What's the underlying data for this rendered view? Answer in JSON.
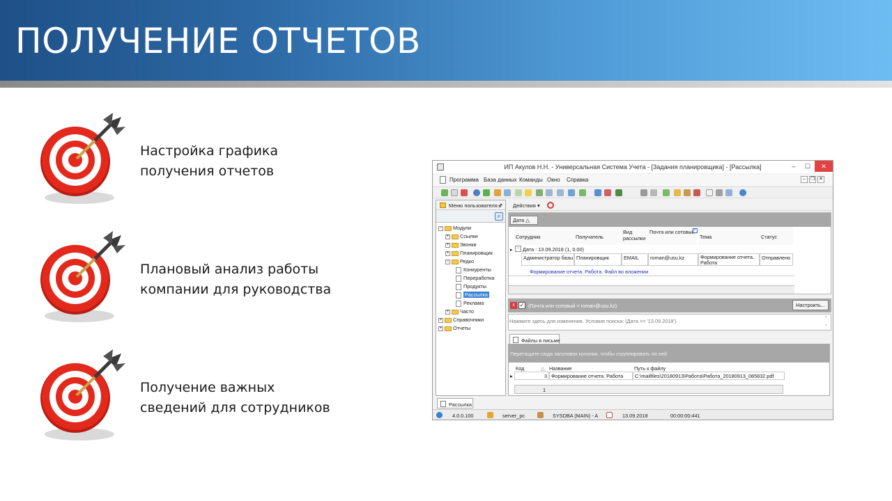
{
  "slide": {
    "title": "ПОЛУЧЕНИЕ ОТЧЕТОВ",
    "bullets": [
      {
        "line1": "Настройка графика",
        "line2": "получения отчетов",
        "icon": "target-dart-icon"
      },
      {
        "line1": "Плановый анализ работы",
        "line2": "компании для руководства",
        "icon": "target-dart-icon"
      },
      {
        "line1": "Получение важных",
        "line2": "сведений для сотрудников",
        "icon": "target-dart-icon"
      }
    ]
  },
  "app": {
    "window_title": "ИП Акулов Н.Н. - Универсальная Система Учета - [Задания планировщика] - [Рассылка]",
    "window_buttons": {
      "minimize": "–",
      "maximize": "☐",
      "close": "✕"
    },
    "menu": [
      "Программа",
      "База данных",
      "Команды",
      "Окно",
      "Справка"
    ],
    "left_panel": {
      "title": "Меню пользователя",
      "pin": "🖈",
      "tree": [
        {
          "label": "Модули",
          "pm": "−"
        },
        {
          "label": "Ссылки",
          "pm": "+"
        },
        {
          "label": "Звонки",
          "pm": "+"
        },
        {
          "label": "Планировщик",
          "pm": "+"
        },
        {
          "label": "Редко",
          "pm": "−"
        },
        {
          "label": "Конкуренты"
        },
        {
          "label": "Переработка"
        },
        {
          "label": "Продукты"
        },
        {
          "label": "Рассылка"
        },
        {
          "label": "Реклама"
        },
        {
          "label": "Часто",
          "pm": "+"
        },
        {
          "label": "Справочники",
          "pm": "+"
        },
        {
          "label": "Отчеты",
          "pm": "+"
        }
      ]
    },
    "actions_label": "Действия ▾",
    "grid": {
      "group_chip": "Дата  △",
      "columns": [
        "Сотрудник",
        "Получатель",
        "Вид рассылки",
        "Почта или сотовый",
        "Тема",
        "Статус"
      ],
      "group_row": "Дата : 13.09.2018 (1, 0.00)",
      "row": {
        "employee": "Администратор базы",
        "recipient": "Планировщик",
        "type": "EMAIL",
        "contact": "roman@usu.kz",
        "subject": "Формирование отчета. Работа",
        "status": "Отправлено"
      },
      "preview": "Формирование отчета. Работа. Файл во вложении"
    },
    "filter": {
      "text": "(Почта или сотовый = roman@usu.kz)",
      "configure": "Настроить...",
      "hint": "Нажмите здесь для изменения. Условие поиска: (Дата  >= '13.09.2018')"
    },
    "files": {
      "tab": "Файлы в письме",
      "group_hint": "Перетащите сюда заголовок колонки, чтобы сгруппировать по ней",
      "columns": [
        "Код",
        "Название",
        "Путь к файлу"
      ],
      "row": {
        "code": "3",
        "name": "Формирование отчета. Работа",
        "path": "C:\\mailfiles\\20180913\\Работа\\Работа_20180913_085832.pdf"
      },
      "count": "1"
    },
    "bottom_tab": "Рассылка",
    "status": {
      "version": "4.0.0.100",
      "server": "server_pc",
      "user": "SYSDBA (MAIN) - A",
      "date": "13.09.2018",
      "timer": "00:00:00:441"
    }
  },
  "colors": {
    "banner_start": "#1f5087",
    "banner_end": "#6dbcf2",
    "target_red": "#e02a1e",
    "selection_blue": "#3b83d6"
  }
}
